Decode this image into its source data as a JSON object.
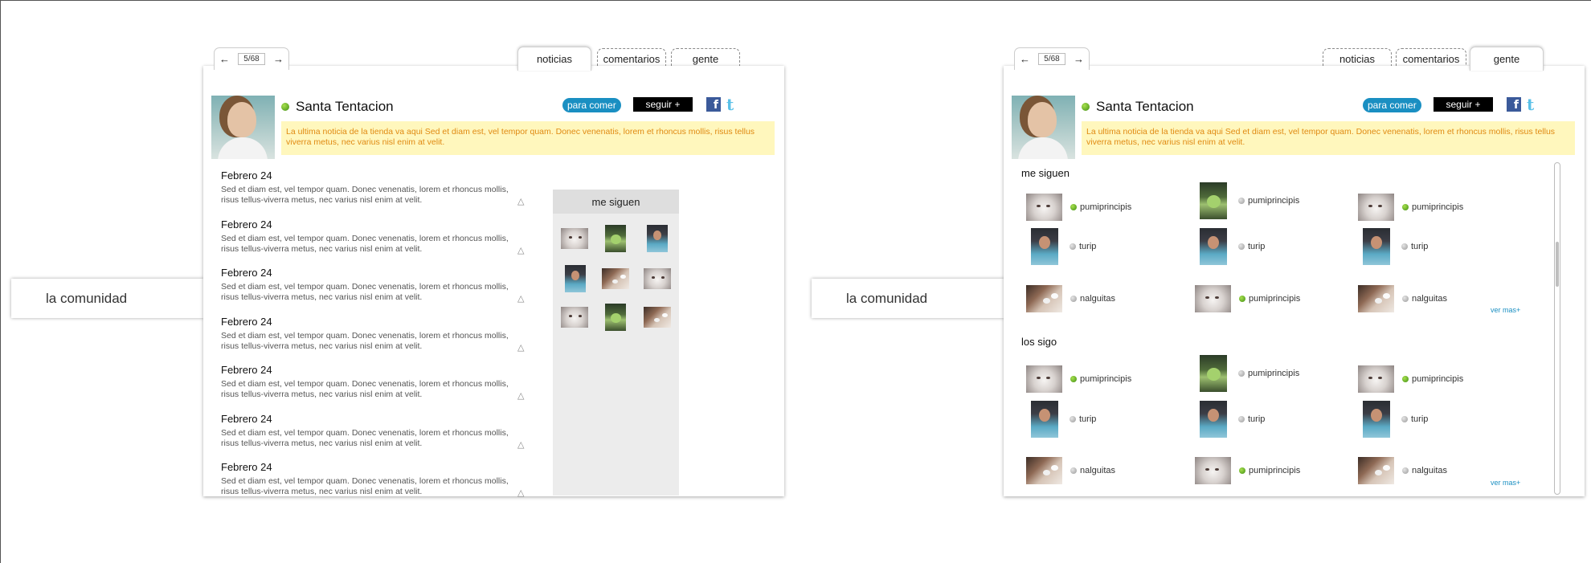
{
  "side_label": "la comunidad",
  "pager": {
    "prev_icon": "arrow-left",
    "next_icon": "arrow-right",
    "count": "5/68"
  },
  "tabs": [
    {
      "label": "noticias"
    },
    {
      "label": "comentarios"
    },
    {
      "label": "gente"
    }
  ],
  "profile": {
    "name": "Santa Tentacion",
    "status_color": "#4f9c1b",
    "category": "para comer",
    "follow_label": "seguir +",
    "facebook_glyph": "f",
    "twitter_glyph": "t"
  },
  "news_banner": "La ultima noticia de la tienda va aqui Sed et diam est, vel tempor quam. Donec venenatis, lorem et rhoncus mollis, risus tellus viverra metus, nec varius nisl enim at velit.",
  "feed": [
    {
      "date": "Febrero 24",
      "text": "Sed et diam est, vel tempor quam. Donec venenatis, lorem et rhoncus mollis, risus tellus-viverra metus, nec varius nisl enim at velit."
    },
    {
      "date": "Febrero 24",
      "text": "Sed et diam est, vel tempor quam. Donec venenatis, lorem et rhoncus mollis, risus tellus-viverra metus, nec varius nisl enim at velit."
    },
    {
      "date": "Febrero 24",
      "text": "Sed et diam est, vel tempor quam. Donec venenatis, lorem et rhoncus mollis, risus tellus-viverra metus, nec varius nisl enim at velit."
    },
    {
      "date": "Febrero 24",
      "text": "Sed et diam est, vel tempor quam. Donec venenatis, lorem et rhoncus mollis, risus tellus-viverra metus, nec varius nisl enim at velit."
    },
    {
      "date": "Febrero 24",
      "text": "Sed et diam est, vel tempor quam. Donec venenatis, lorem et rhoncus mollis, risus tellus-viverra metus, nec varius nisl enim at velit."
    },
    {
      "date": "Febrero 24",
      "text": "Sed et diam est, vel tempor quam. Donec venenatis, lorem et rhoncus mollis, risus tellus-viverra metus, nec varius nisl enim at velit."
    },
    {
      "date": "Febrero 24",
      "text": "Sed et diam est, vel tempor quam. Donec venenatis, lorem et rhoncus mollis, risus tellus-viverra metus, nec varius nisl enim at velit."
    }
  ],
  "followers_box": {
    "title": "me siguen"
  },
  "people": {
    "me_siguen": {
      "title": "me siguen",
      "items": [
        {
          "name": "pumiprincipis",
          "online": true
        },
        {
          "name": "pumiprincipis",
          "online": false
        },
        {
          "name": "pumiprincipis",
          "online": true
        },
        {
          "name": "turip",
          "online": false
        },
        {
          "name": "turip",
          "online": false
        },
        {
          "name": "turip",
          "online": false
        },
        {
          "name": "nalguitas",
          "online": false
        },
        {
          "name": "pumiprincipis",
          "online": true
        },
        {
          "name": "nalguitas",
          "online": false
        }
      ],
      "see_more": "ver mas+"
    },
    "los_sigo": {
      "title": "los sigo",
      "items": [
        {
          "name": "pumiprincipis",
          "online": true
        },
        {
          "name": "pumiprincipis",
          "online": false
        },
        {
          "name": "pumiprincipis",
          "online": true
        },
        {
          "name": "turip",
          "online": false
        },
        {
          "name": "turip",
          "online": false
        },
        {
          "name": "turip",
          "online": false
        },
        {
          "name": "nalguitas",
          "online": false
        },
        {
          "name": "pumiprincipis",
          "online": true
        },
        {
          "name": "nalguitas",
          "online": false
        }
      ],
      "see_more": "ver mas+"
    }
  },
  "colors": {
    "accent_blue": "#1a8fc2",
    "banner_bg": "#fff7bd",
    "banner_text": "#e08a12",
    "online": "#4f9c1b",
    "offline": "#9a9a9a"
  }
}
